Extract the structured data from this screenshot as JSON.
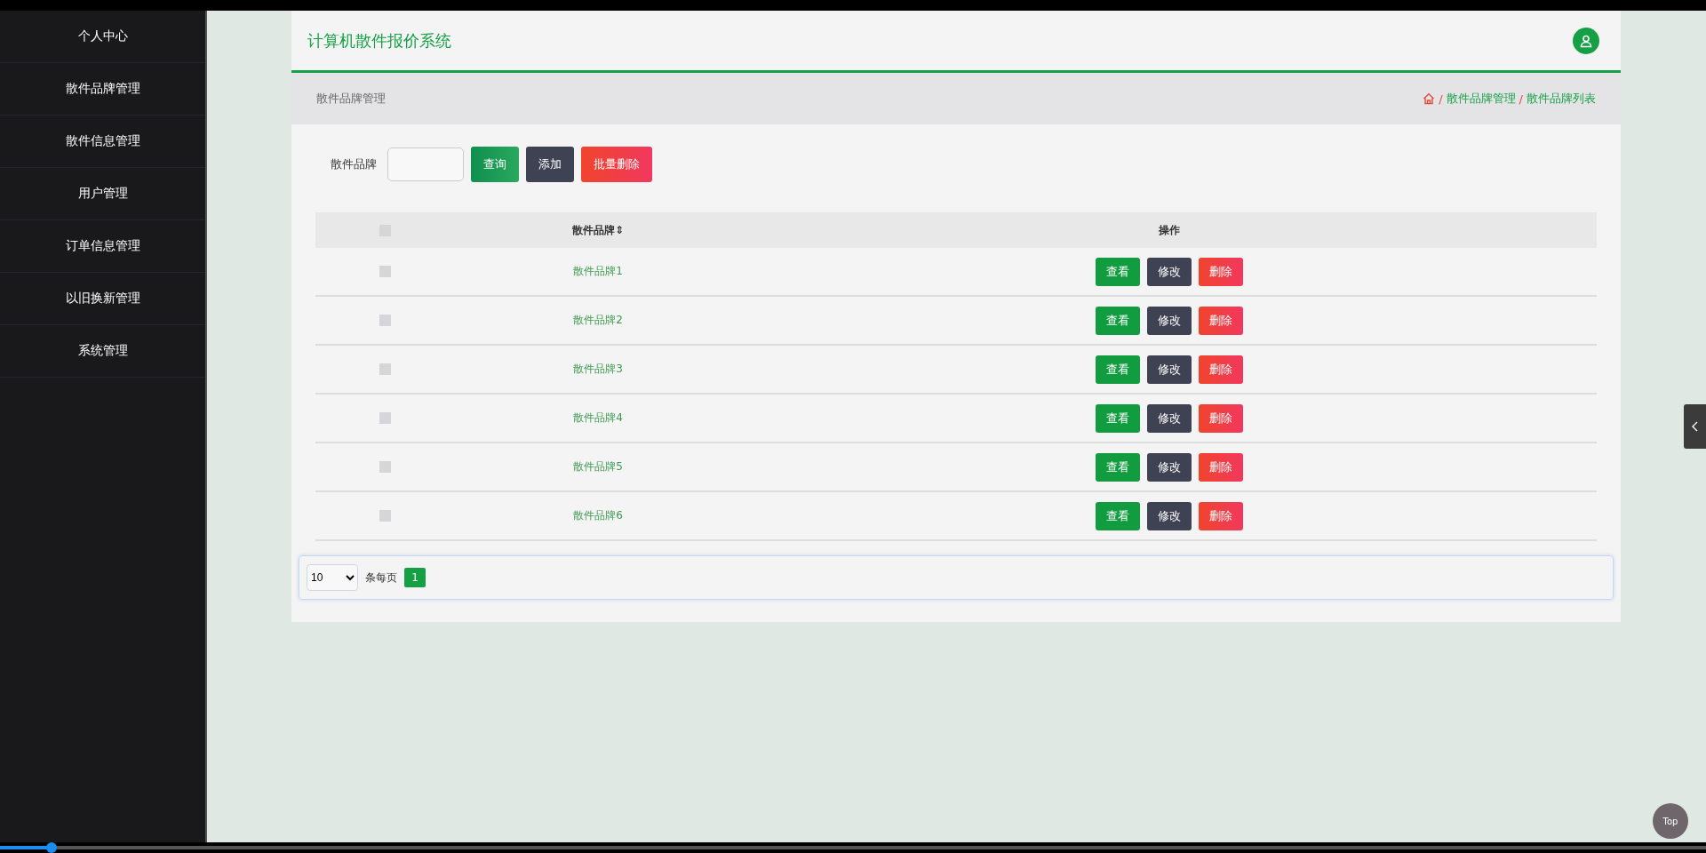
{
  "sidebar": {
    "items": [
      {
        "label": "个人中心"
      },
      {
        "label": "散件品牌管理"
      },
      {
        "label": "散件信息管理"
      },
      {
        "label": "用户管理"
      },
      {
        "label": "订单信息管理"
      },
      {
        "label": "以旧换新管理"
      },
      {
        "label": "系统管理"
      }
    ]
  },
  "header": {
    "title": "计算机散件报价系统"
  },
  "breadcrumb": {
    "page_title": "散件品牌管理",
    "separator": "/",
    "trail": [
      "散件品牌管理",
      "散件品牌列表"
    ]
  },
  "search": {
    "label": "散件品牌",
    "buttons": [
      {
        "label": "查询",
        "kind": "query"
      },
      {
        "label": "添加",
        "kind": "add"
      },
      {
        "label": "批量删除",
        "kind": "delete"
      }
    ]
  },
  "table": {
    "header_checked": false,
    "columns": [
      "散件品牌⇕",
      "操作"
    ],
    "rows": [
      {
        "checked": false,
        "brand": "散件品牌1",
        "actions": [
          {
            "label": "查看",
            "kind": "view"
          },
          {
            "label": "修改",
            "kind": "edit"
          },
          {
            "label": "删除",
            "kind": "delete"
          }
        ]
      },
      {
        "checked": false,
        "brand": "散件品牌2",
        "actions": [
          {
            "label": "查看",
            "kind": "view"
          },
          {
            "label": "修改",
            "kind": "edit"
          },
          {
            "label": "删除",
            "kind": "delete"
          }
        ]
      },
      {
        "checked": false,
        "brand": "散件品牌3",
        "actions": [
          {
            "label": "查看",
            "kind": "view"
          },
          {
            "label": "修改",
            "kind": "edit"
          },
          {
            "label": "删除",
            "kind": "delete"
          }
        ]
      },
      {
        "checked": false,
        "brand": "散件品牌4",
        "actions": [
          {
            "label": "查看",
            "kind": "view"
          },
          {
            "label": "修改",
            "kind": "edit"
          },
          {
            "label": "删除",
            "kind": "delete"
          }
        ]
      },
      {
        "checked": false,
        "brand": "散件品牌5",
        "actions": [
          {
            "label": "查看",
            "kind": "view"
          },
          {
            "label": "修改",
            "kind": "edit"
          },
          {
            "label": "删除",
            "kind": "delete"
          }
        ]
      },
      {
        "checked": false,
        "brand": "散件品牌6",
        "actions": [
          {
            "label": "查看",
            "kind": "view"
          },
          {
            "label": "修改",
            "kind": "edit"
          },
          {
            "label": "删除",
            "kind": "delete"
          }
        ]
      }
    ]
  },
  "pagination": {
    "page_size": "10",
    "per_page_label": "条每页",
    "pages": [
      {
        "label": "1",
        "selected": true
      }
    ]
  },
  "back_to_top": {
    "label": "Top"
  },
  "video_player": {
    "level": 0.03
  }
}
